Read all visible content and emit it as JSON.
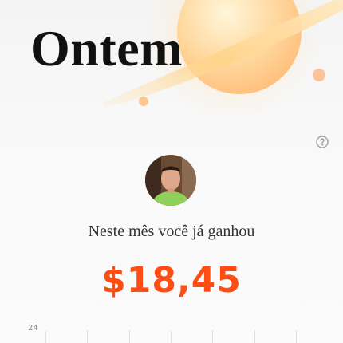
{
  "header": {
    "title": "Ontem",
    "banner_icon": "planet-icon",
    "help_icon": "question-circle-icon"
  },
  "summary": {
    "label": "Neste mês você já ganhou",
    "amount": "$18,45",
    "amount_color": "#ff4d14",
    "avatar": "user-avatar"
  },
  "calendar": {
    "first_day": "24"
  }
}
